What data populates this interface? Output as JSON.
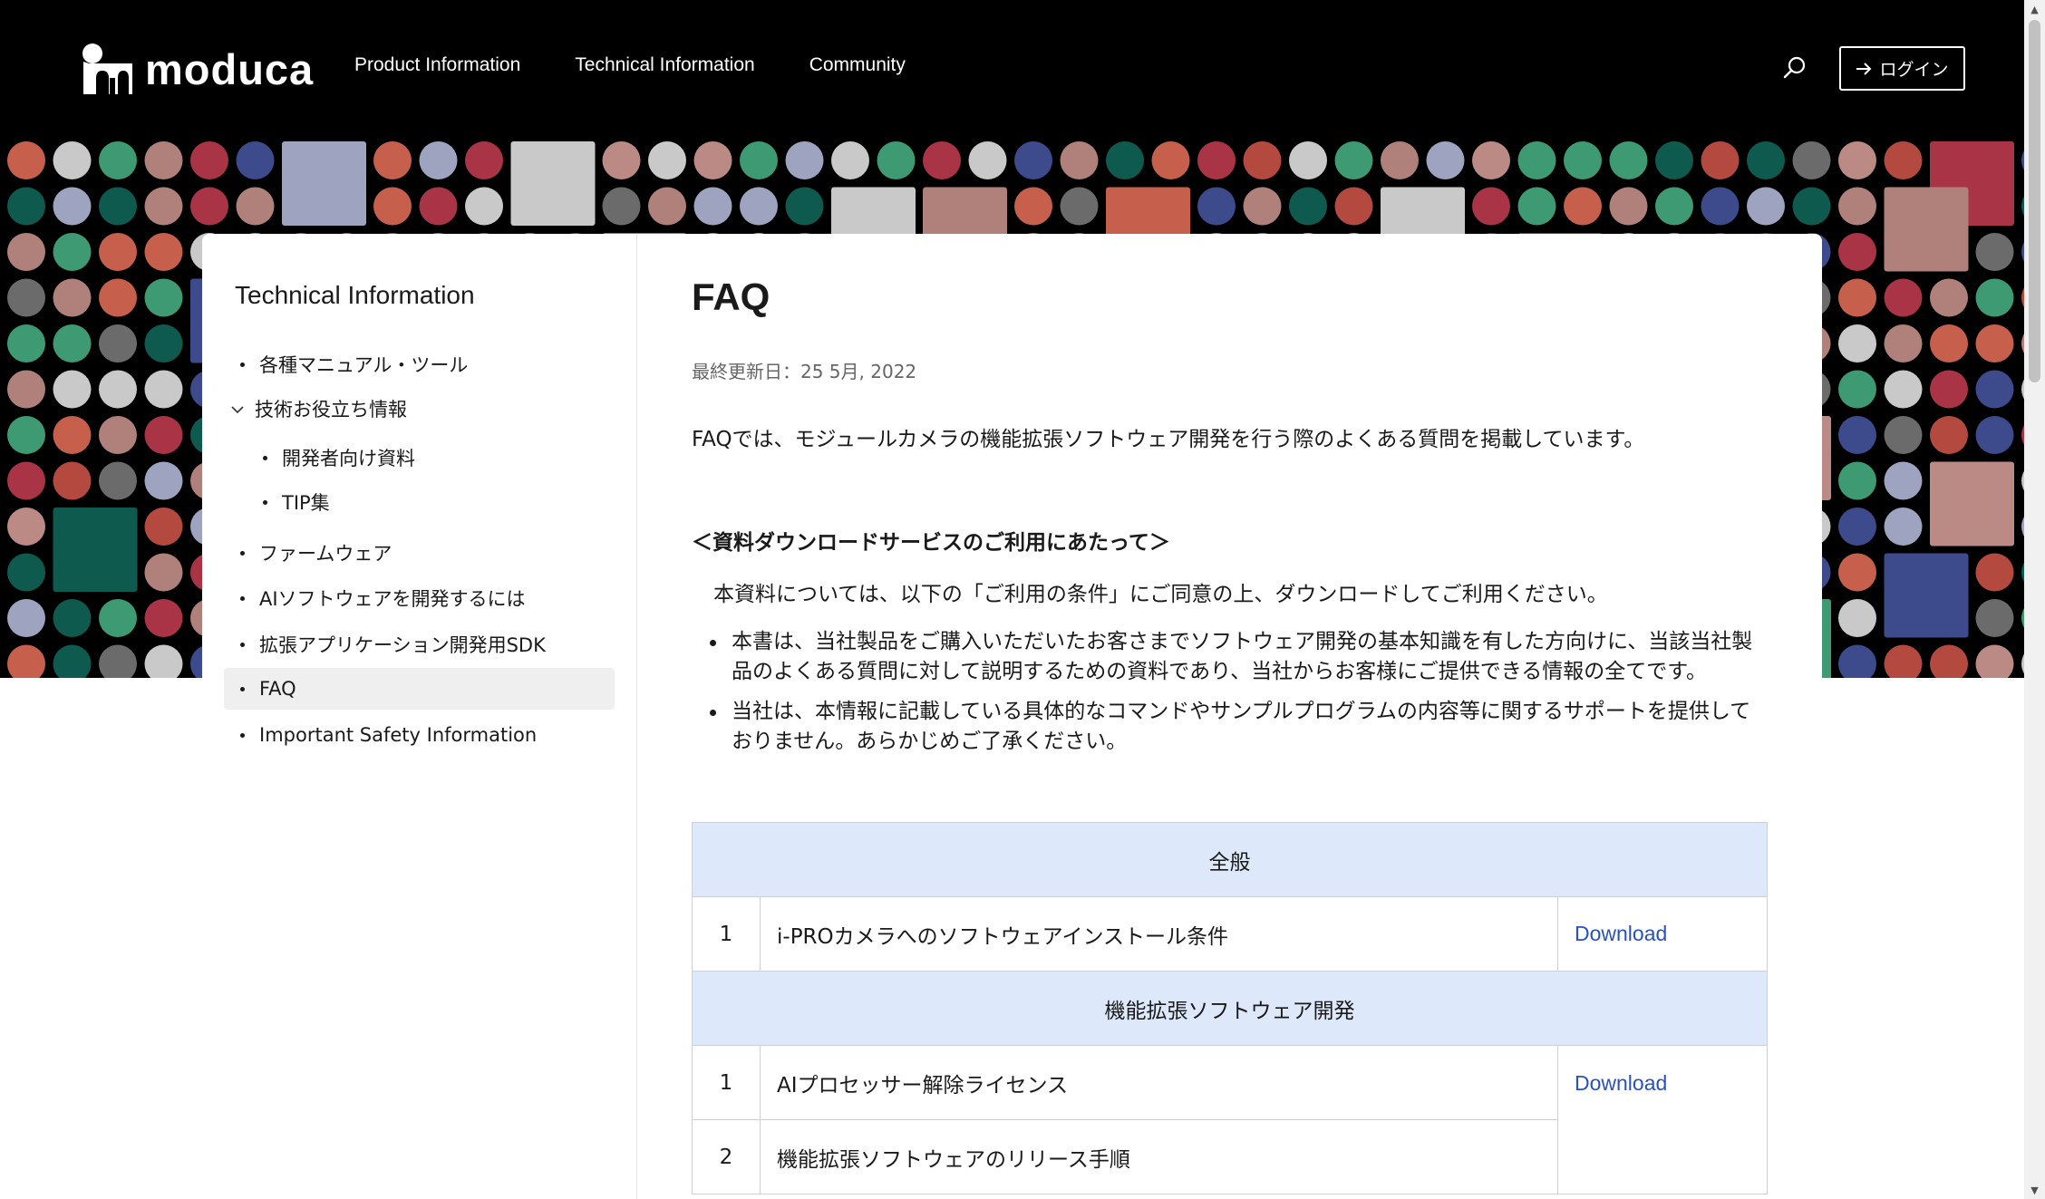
{
  "header": {
    "logo_text": "moduca",
    "nav": [
      "Product Information",
      "Technical Information",
      "Community"
    ],
    "login_label": "ログイン",
    "search_icon": "search-icon",
    "login_icon": "arrow-right-icon"
  },
  "sidebar": {
    "title": "Technical Information",
    "items": [
      {
        "label": "各種マニュアル・ツール"
      },
      {
        "label": "技術お役立ち情報"
      },
      {
        "label": "開発者向け資料"
      },
      {
        "label": "TIP集"
      },
      {
        "label": "ファームウェア"
      },
      {
        "label": "AIソフトウェアを開発するには"
      },
      {
        "label": "拡張アプリケーション開発用SDK"
      },
      {
        "label": "FAQ"
      },
      {
        "label": "Important Safety Information"
      }
    ]
  },
  "main": {
    "title": "FAQ",
    "updated": "最終更新日：25 5月, 2022",
    "intro": "FAQでは、モジュールカメラの機能拡張ソフトウェア開発を行う際のよくある質問を掲載しています。",
    "notice_heading": "＜資料ダウンロードサービスのご利用にあたって＞",
    "notice_body": "本資料については、以下の「ご利用の条件」にご同意の上、ダウンロードしてご利用ください。",
    "notice_items": [
      "本書は、当社製品をご購入いただいたお客さまでソフトウェア開発の基本知識を有した方向けに、当該当社製品のよくある質問に対して説明するための資料であり、当社からお客様にご提供できる情報の全てです。",
      "当社は、本情報に記載している具体的なコマンドやサンプルプログラムの内容等に関するサポートを提供しておりません。あらかじめご了承ください。"
    ]
  },
  "table": {
    "sections": [
      {
        "heading": "全般",
        "rows": [
          {
            "num": "1",
            "title": "i-PROカメラへのソフトウェアインストール条件",
            "link": "Download"
          }
        ]
      },
      {
        "heading": "機能拡張ソフトウェア開発",
        "rows": [
          {
            "num": "1",
            "title": "AIプロセッサー解除ライセンス",
            "link": "Download"
          },
          {
            "num": "2",
            "title": "機能拡張ソフトウェアのリリース手順",
            "link": ""
          }
        ]
      }
    ]
  },
  "colors": {
    "header_bg": "#000000",
    "section_bg": "#dde9fb",
    "link": "#2a52be",
    "pattern": [
      "#b0807a",
      "#c9c9c9",
      "#0f5a4e",
      "#3d4a8c",
      "#3d9a72",
      "#c75f4d",
      "#a83445",
      "#9ea3bf",
      "#b44a3f",
      "#6b6b6b",
      "#bc8a84"
    ]
  }
}
